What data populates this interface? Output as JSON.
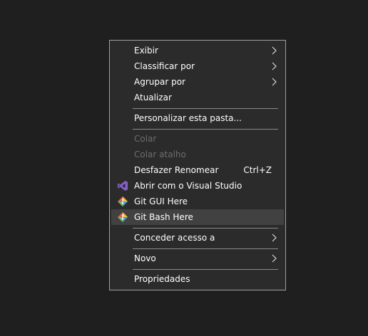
{
  "context_menu": {
    "items": [
      {
        "label": "Exibir",
        "has_submenu": true
      },
      {
        "label": "Classificar por",
        "has_submenu": true
      },
      {
        "label": "Agrupar por",
        "has_submenu": true
      },
      {
        "label": "Atualizar"
      },
      {
        "label": "Personalizar esta pasta..."
      },
      {
        "label": "Colar",
        "disabled": true
      },
      {
        "label": "Colar atalho",
        "disabled": true
      },
      {
        "label": "Desfazer Renomear",
        "shortcut": "Ctrl+Z"
      },
      {
        "label": "Abrir com o Visual Studio",
        "icon": "visual-studio-icon"
      },
      {
        "label": "Git GUI Here",
        "icon": "git-gui-icon"
      },
      {
        "label": "Git Bash Here",
        "icon": "git-bash-icon",
        "highlighted": true
      },
      {
        "label": "Conceder acesso a",
        "has_submenu": true
      },
      {
        "label": "Novo",
        "has_submenu": true
      },
      {
        "label": "Propriedades"
      }
    ]
  },
  "colors": {
    "desktop_background": "#1f1f1f",
    "menu_background": "#2b2b2b",
    "menu_border": "#a0a0a0",
    "highlight_background": "#414141",
    "text": "#ffffff",
    "disabled_text": "#6d6d6d"
  }
}
